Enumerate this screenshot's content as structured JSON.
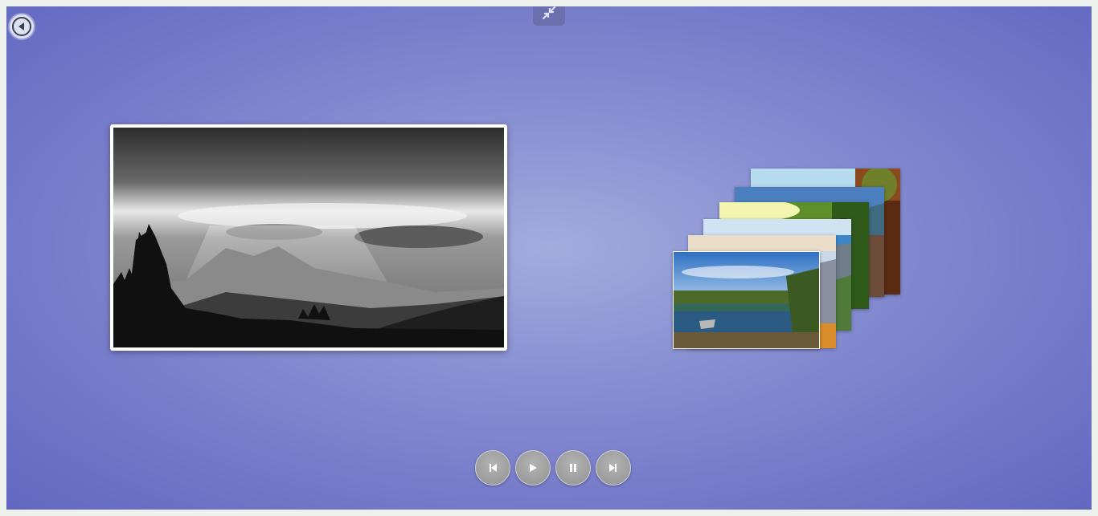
{
  "colors": {
    "stage_background": "#8990d2",
    "control_button": "#a0a0a0",
    "fullscreen_tab": "#6a6fae"
  },
  "navigation": {
    "back_icon": "back-arrow-circle-icon",
    "fullscreen_icon": "exit-fullscreen-icon"
  },
  "main_image": {
    "description_icon": "black-and-white-mountain-sun-rays-photo"
  },
  "thumbnail_stack": [
    {
      "subject": "lake-with-boat-and-trees"
    },
    {
      "subject": "mountain-valley-clouds"
    },
    {
      "subject": "mountain-slopes-blue-sky"
    },
    {
      "subject": "sunlit-green-forest"
    },
    {
      "subject": "blue-sky-mountain-lake"
    },
    {
      "subject": "autumn-trees-sky"
    }
  ],
  "controls": {
    "previous_icon": "skip-previous-icon",
    "play_icon": "play-icon",
    "pause_icon": "pause-icon",
    "next_icon": "skip-next-icon"
  }
}
